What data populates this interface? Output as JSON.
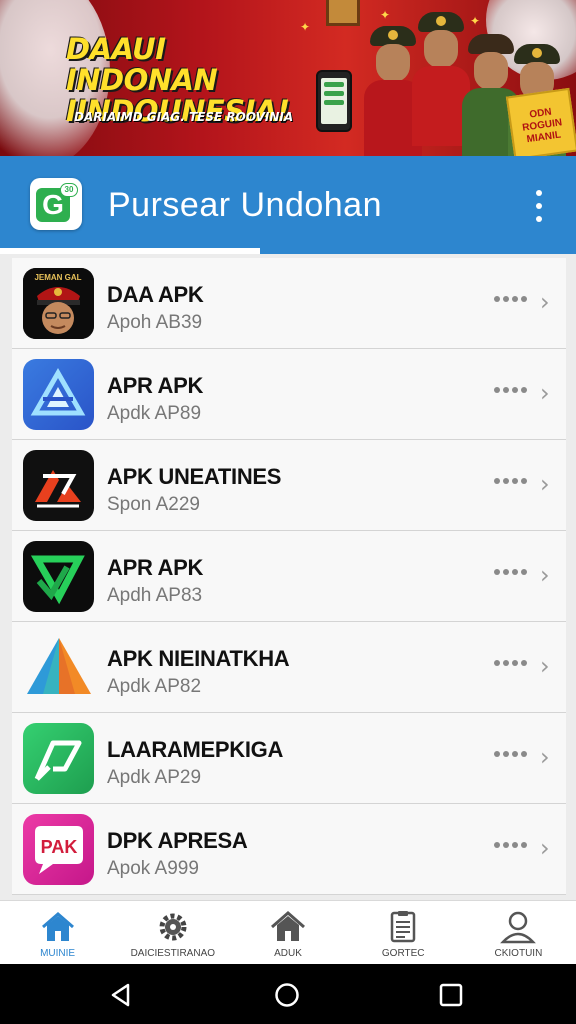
{
  "banner": {
    "title_line1": "DAAUI INDONAN",
    "title_line2": "IINDOUNESIA!",
    "subtitle": "DARIAIMD GIAG. TESE ROOVINIA",
    "sign_text": "ODN ROGUIN MIANIL"
  },
  "appbar": {
    "logo_badge": "30",
    "title": "Pursear Undohan",
    "menu_icon": "more-vert-icon"
  },
  "apps": [
    {
      "name": "DAA APK",
      "subtitle": "Apoh AB39",
      "icon_label": "JEMAN GAL"
    },
    {
      "name": "APR APK",
      "subtitle": "Apdk AP89",
      "icon_label": ""
    },
    {
      "name": "APK UNEATINES",
      "subtitle": "Spon A229",
      "icon_label": ""
    },
    {
      "name": "APR APK",
      "subtitle": "Apdh AP83",
      "icon_label": ""
    },
    {
      "name": "APK NIEINATKHA",
      "subtitle": "Apdk AP82",
      "icon_label": ""
    },
    {
      "name": "LAARAMEPKIGA",
      "subtitle": "Apdk AP29",
      "icon_label": ""
    },
    {
      "name": "DPK APRESA",
      "subtitle": "Apok A999",
      "icon_label": "PAK"
    }
  ],
  "bottom_nav": [
    {
      "label": "MUINIE",
      "icon": "home-icon",
      "active": true
    },
    {
      "label": "DAICIESTIRANAO",
      "icon": "gear-icon",
      "active": false
    },
    {
      "label": "ADUK",
      "icon": "house-icon",
      "active": false
    },
    {
      "label": "GORTEC",
      "icon": "document-icon",
      "active": false
    },
    {
      "label": "CKIOTUIN",
      "icon": "user-icon",
      "active": false
    }
  ],
  "system_nav": [
    "back-icon",
    "home-circle-icon",
    "recents-icon"
  ],
  "colors": {
    "accent": "#2d86cf",
    "banner_red": "#b3141b",
    "title_yellow": "#ffe02b"
  }
}
